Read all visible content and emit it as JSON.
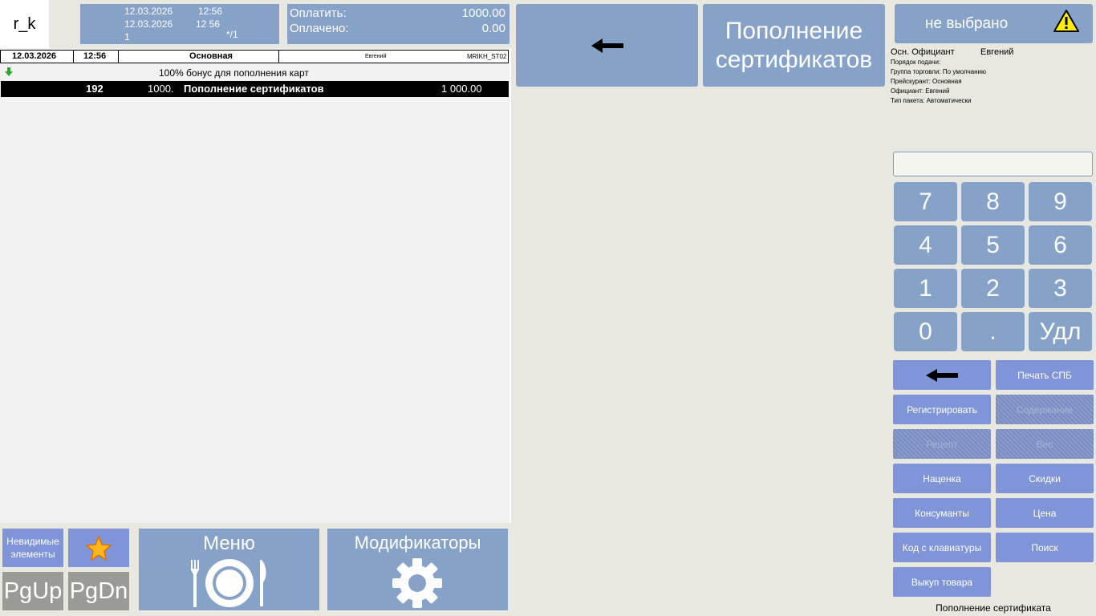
{
  "logo": "r_k",
  "header": {
    "date1": "12.03.2026",
    "time1": "12:56",
    "date2": "12.03.2026",
    "time2": "12 56",
    "guests": "1",
    "table": "*/1"
  },
  "payment": {
    "to_pay_label": "Оплатить:",
    "to_pay_value": "1000.00",
    "paid_label": "Оплачено:",
    "paid_value": "0.00"
  },
  "order": {
    "date": "12.03.2026",
    "time": "12:56",
    "category": "Основная",
    "waiter": "Евгений",
    "station": "MRIKH_ST02",
    "promo": "100% бонус для пополнения карт",
    "line": {
      "code": "192",
      "price": "1000.",
      "name": "Пополнение сертификатов",
      "sum": "1 000.00"
    }
  },
  "top_buttons": {
    "category": "Пополнение сертификатов"
  },
  "status": {
    "selected": "не выбрано"
  },
  "info": {
    "waiter_label": "Осн. Официант",
    "waiter_value": "Евгений",
    "line1": "Порядок подачи:",
    "line2": "Группа торговли: По умолчанию",
    "line3": "Прейскурант: Основная",
    "line4": "Официант: Евгений",
    "line5": "Тип пакета: Автоматически"
  },
  "keypad": [
    "7",
    "8",
    "9",
    "4",
    "5",
    "6",
    "1",
    "2",
    "3",
    "0",
    ".",
    "Удл"
  ],
  "functions": {
    "print": "Печать СПБ",
    "register": "Регистрировать",
    "content": "Содержание",
    "recipe": "Рецепт",
    "weight": "Вес",
    "markup": "Наценка",
    "discounts": "Скидки",
    "consumables": "Консуманты",
    "price": "Цена",
    "keyboard_code": "Код с клавиатуры",
    "search": "Поиск",
    "buyback": "Выкуп товара"
  },
  "bottom": {
    "invisible": "Невидимые элементы",
    "pgup": "PgUp",
    "pgdn": "PgDn",
    "menu": "Меню",
    "modifiers": "Модификаторы"
  },
  "status_bar": "Пополнение сертификата"
}
